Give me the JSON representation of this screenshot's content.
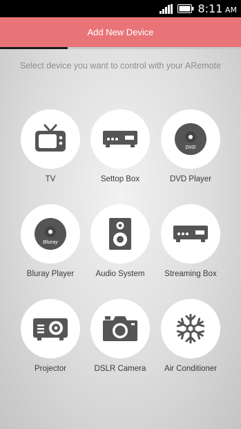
{
  "status_bar": {
    "time": "8:11",
    "time_suffix": "AM",
    "icons": [
      "signal-icon",
      "battery-icon"
    ]
  },
  "header": {
    "title": "Add New Device",
    "background_color": "#e87478",
    "progress": 0.28
  },
  "subtitle": "Select device you want to control with your ARemote",
  "devices": [
    {
      "label": "TV",
      "icon": "tv-icon"
    },
    {
      "label": "Settop Box",
      "icon": "settop-box-icon"
    },
    {
      "label": "DVD Player",
      "icon": "dvd-disc-icon",
      "icon_text": "DVD"
    },
    {
      "label": "Bluray Player",
      "icon": "bluray-disc-icon",
      "icon_text": "Bluray"
    },
    {
      "label": "Audio System",
      "icon": "speaker-icon"
    },
    {
      "label": "Streaming Box",
      "icon": "streaming-box-icon"
    },
    {
      "label": "Projector",
      "icon": "projector-icon"
    },
    {
      "label": "DSLR Camera",
      "icon": "camera-icon"
    },
    {
      "label": "Air Conditioner",
      "icon": "snowflake-icon"
    }
  ]
}
